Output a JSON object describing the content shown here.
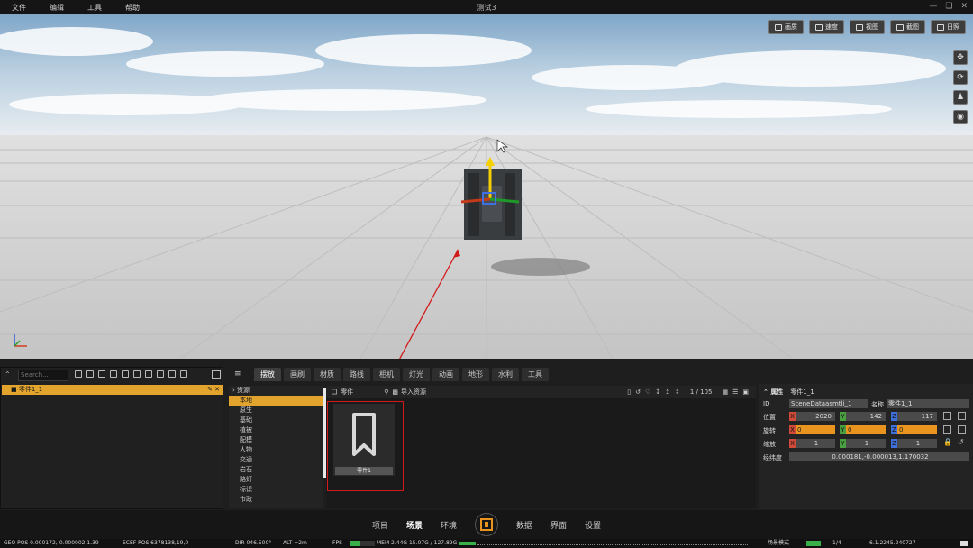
{
  "window": {
    "title": "测试3"
  },
  "menu": [
    "文件",
    "编辑",
    "工具",
    "帮助"
  ],
  "viewport": {
    "top_buttons": [
      "画质",
      "速度",
      "视图",
      "截图",
      "日照"
    ],
    "side_icons": [
      "move-icon",
      "rotate-icon",
      "person-icon",
      "globe-icon"
    ]
  },
  "outliner": {
    "search_placeholder": "Search...",
    "rows": [
      {
        "label": "零件1_1"
      }
    ]
  },
  "tabs": [
    "摆放",
    "画刷",
    "材质",
    "路线",
    "相机",
    "灯光",
    "动画",
    "地形",
    "水利",
    "工具"
  ],
  "categories": [
    {
      "label": "资源",
      "type": "header"
    },
    {
      "label": "本地",
      "type": "selected"
    },
    {
      "label": "原生"
    },
    {
      "label": "基础"
    },
    {
      "label": "植被"
    },
    {
      "label": "配模"
    },
    {
      "label": "人物"
    },
    {
      "label": "交通"
    },
    {
      "label": "岩石"
    },
    {
      "label": "路灯"
    },
    {
      "label": "标识"
    },
    {
      "label": "市政"
    }
  ],
  "assets": {
    "filter_label": "零件",
    "import_label": "导入资源",
    "page": "1 / 105",
    "items": [
      {
        "name": "零件1"
      }
    ]
  },
  "properties": {
    "header": "属性",
    "object_name": "零件1_1",
    "id_label": "ID",
    "id_value": "SceneDataasmtli_1",
    "name_label": "名称",
    "name_value": "零件1_1",
    "position_label": "位置",
    "rotation_label": "旋转",
    "scale_label": "缩放",
    "latlon_label": "经纬度",
    "position": [
      "2020",
      "142",
      "117"
    ],
    "rotation": [
      "0",
      "0",
      "0"
    ],
    "scale": [
      "1",
      "1",
      "1"
    ],
    "latlon": "0.000181,-0.000013,1.170032",
    "axis_labels": [
      "X",
      "Y",
      "Z"
    ]
  },
  "bottom_nav": [
    "项目",
    "场景",
    "环境",
    "数据",
    "界面",
    "设置"
  ],
  "status": {
    "geo_pos": "GEO POS  0.000172,-0.000002,1.39",
    "ecef_pos": "ECEF POS  6378138,19,0",
    "dir": "DIR  046.500°",
    "alt": "ALT  +2m",
    "fps": "FPS",
    "mem": "MEM  2.44G  15.07G / 127.89G",
    "scene_mode": "场景模式",
    "page": "1/4",
    "version": "6.1.2245.240727"
  }
}
